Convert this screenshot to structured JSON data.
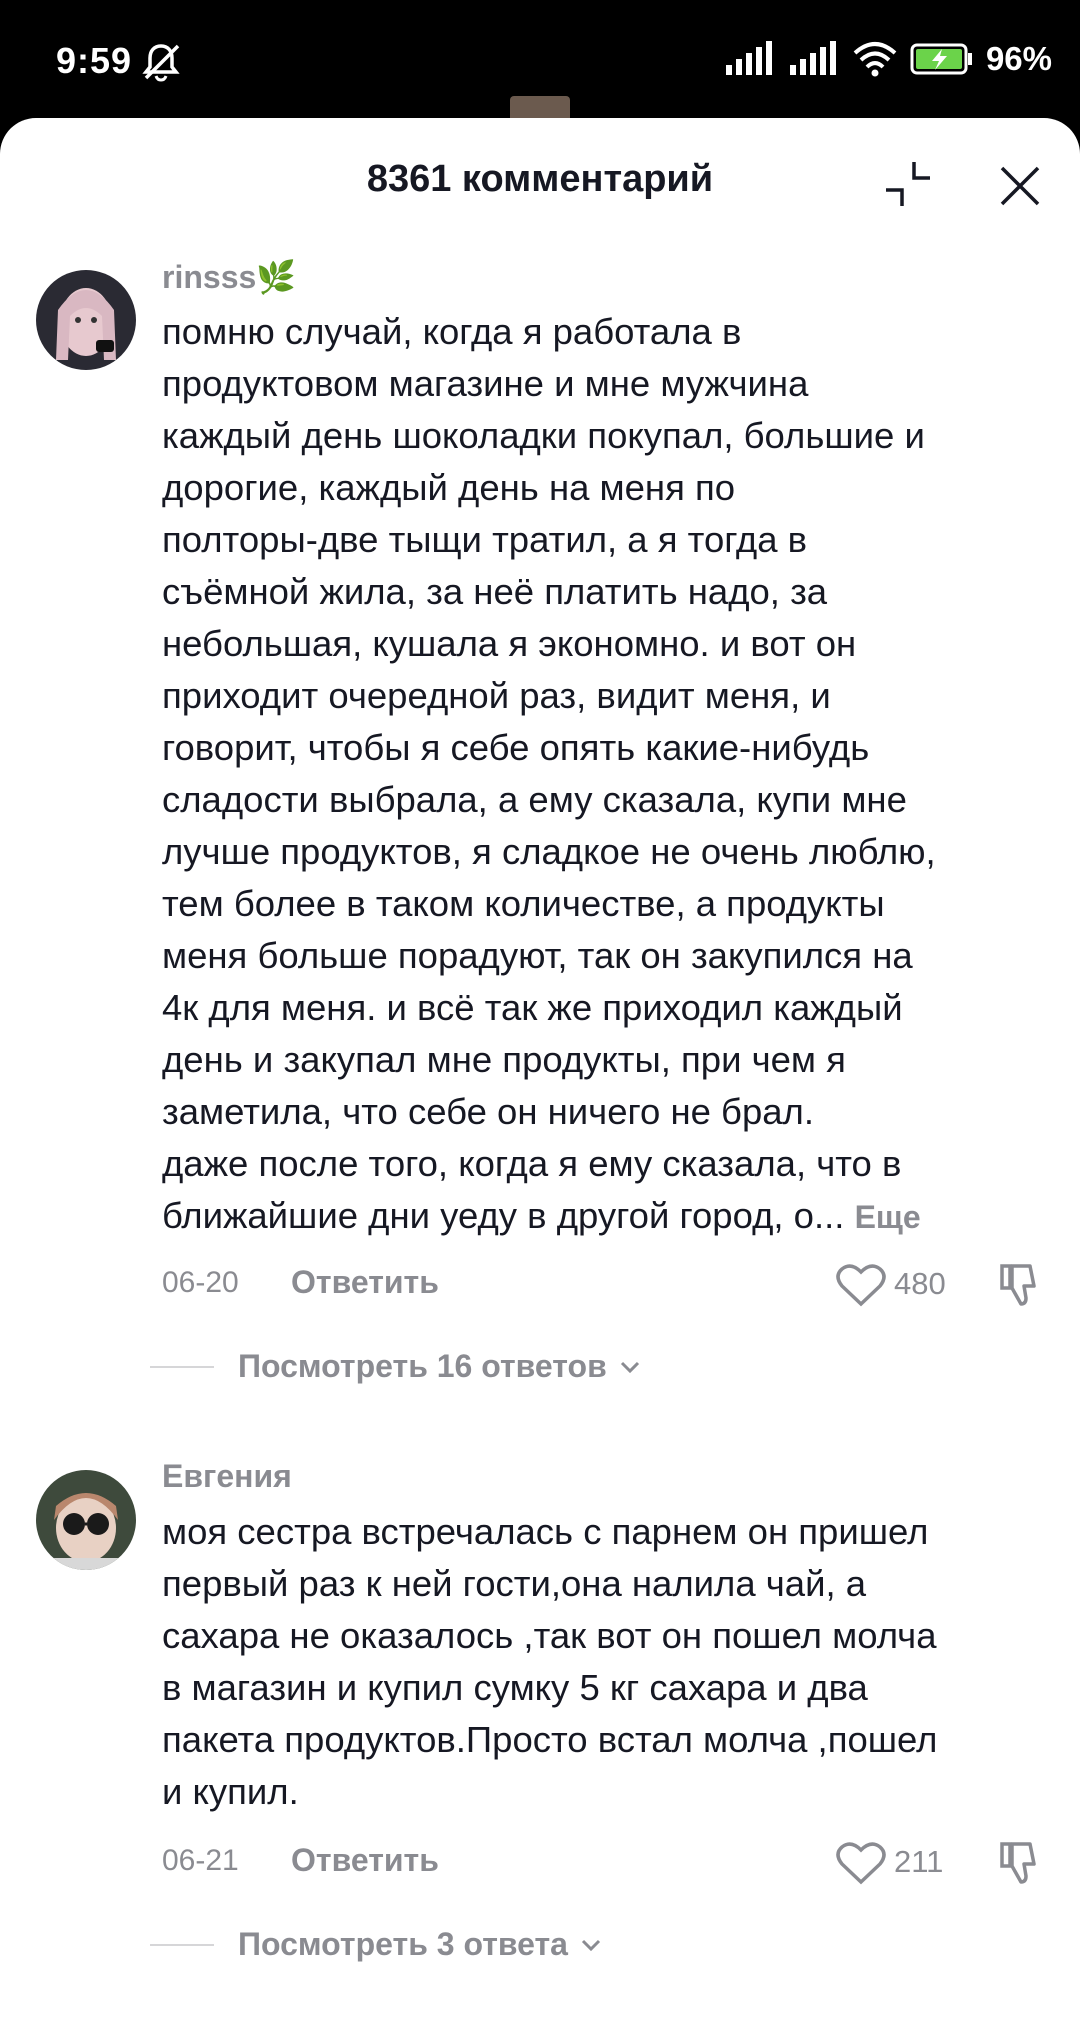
{
  "status_bar": {
    "time": "9:59",
    "battery": "96%",
    "icons": [
      "mute-bell-icon",
      "signal-icon",
      "signal-icon",
      "wifi-icon",
      "battery-charging-icon"
    ]
  },
  "header": {
    "title": "8361 комментарий",
    "collapse_icon": "collapse-icon",
    "close_icon": "close-icon"
  },
  "comments": [
    {
      "username": "rinsss🌿",
      "text": "помню случай, когда я работала в\nпродуктовом магазине и мне мужчина\nкаждый день шоколадки покупал, большие и\nдорогие, каждый день на меня по\nполторы-две тыщи тратил, а я тогда в\nсъёмной жила, за неё платить надо, за\nнебольшая, кушала я экономно. и вот он\nприходит очередной раз, видит меня, и\nговорит, чтобы я себе опять какие-нибудь\nсладости выбрала, а ему сказала, купи мне\nлучше продуктов, я сладкое не очень люблю,\nтем более в таком количестве, а продукты\nменя больше порадуют, так он закупился на\n4к для меня. и всё так же приходил каждый\nдень и закупал мне продукты, при чем я\nзаметила, что себе он ничего не брал.\nдаже после того, когда я ему сказала, что в\nближайшие дни уеду в другой город, о...",
      "more": "Еще",
      "date": "06-20",
      "reply": "Ответить",
      "likes": "480",
      "view_replies": "Посмотреть 16 ответов"
    },
    {
      "username": "Евгения",
      "text": "моя сестра встречалась с парнем он пришел\nпервый раз к ней гости,она налила чай, а\nсахара не оказалось ,так вот он пошел молча\nв магазин и купил сумку 5 кг сахара и два\nпакета продуктов.Просто встал молча ,пошел\nи купил.",
      "date": "06-21",
      "reply": "Ответить",
      "likes": "211",
      "view_replies": "Посмотреть 3 ответа"
    }
  ]
}
